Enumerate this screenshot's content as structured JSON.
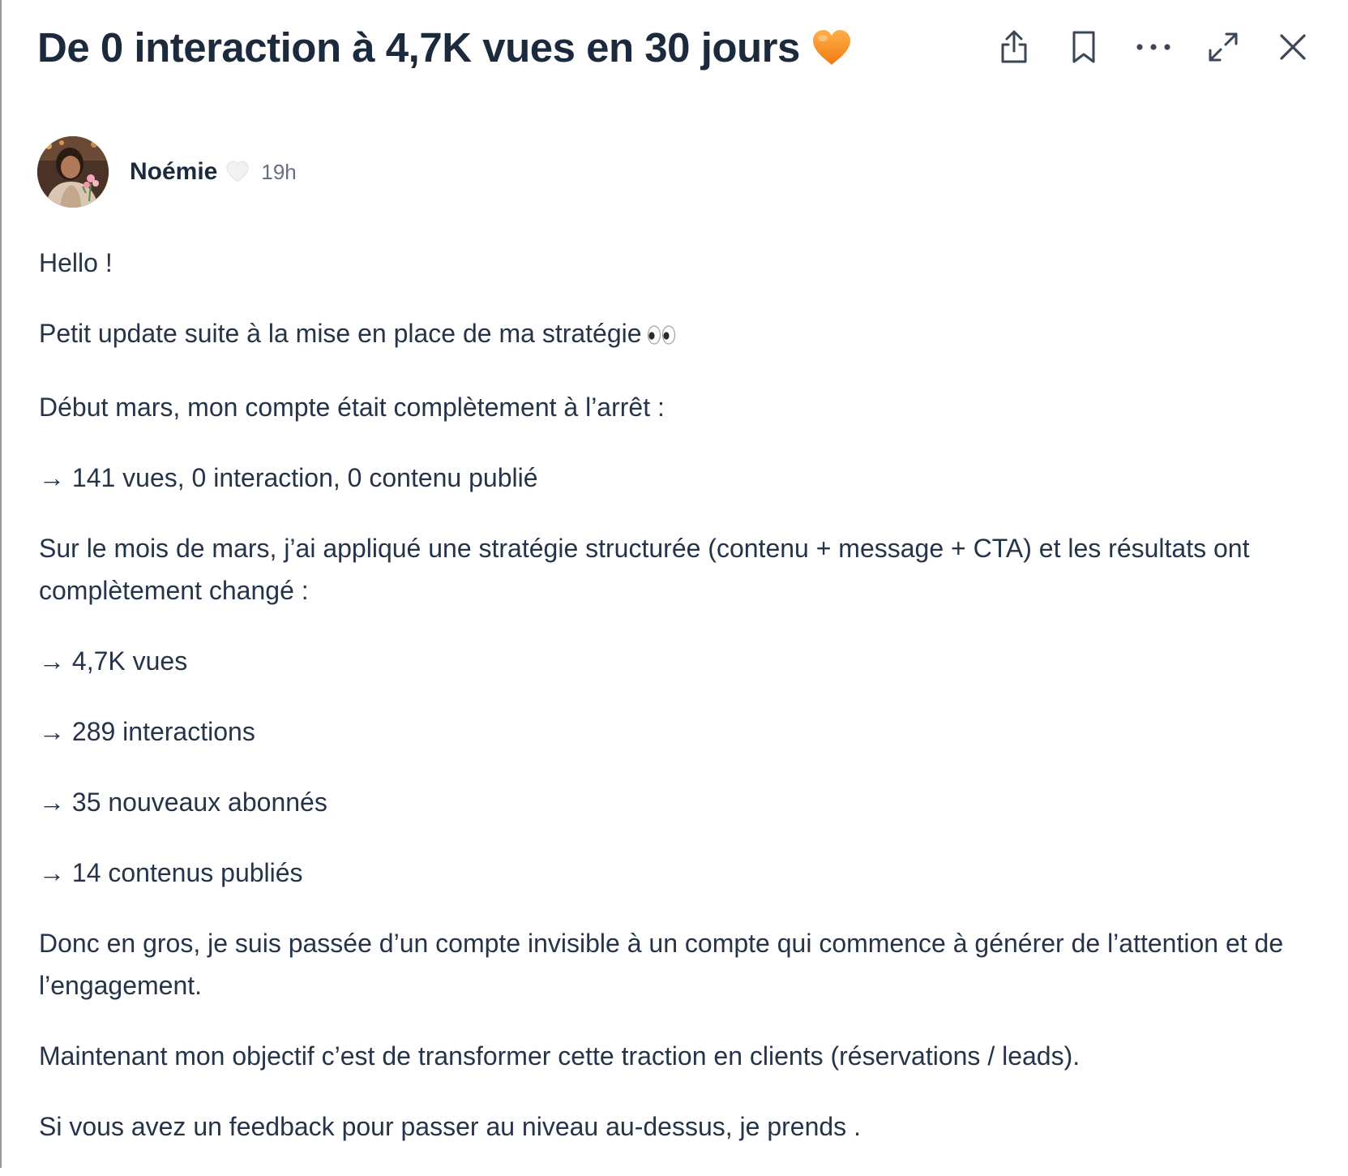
{
  "post": {
    "title": "De 0 interaction à 4,7K vues en 30 jours",
    "title_emoji": "orange-heart-icon",
    "author": {
      "name": "Noémie",
      "badge": "white-heart-icon",
      "time": "19h"
    },
    "paragraphs": [
      "Hello !",
      "Petit update suite à la mise en place de ma stratégie",
      "Début mars, mon compte était complètement à l’arrêt :",
      "→ 141 vues, 0 interaction, 0 contenu publié",
      "Sur le mois de mars, j’ai appliqué une stratégie structurée (contenu + message + CTA) et les résultats ont complètement changé :",
      "→ 4,7K vues",
      "→ 289 interactions",
      "→ 35 nouveaux abonnés",
      "→ 14 contenus publiés",
      "Donc en gros, je suis passée d’un compte invisible à un compte qui commence à générer de l’attention et de l’engagement.",
      "Maintenant mon objectif c’est de transformer cette traction en clients (réservations / leads).",
      "Si vous avez un feedback pour passer au niveau au-dessus, je prends ."
    ],
    "paragraph_2_emoji": "eyes-icon"
  },
  "toolbar": {
    "icons": [
      "share-icon",
      "bookmark-icon",
      "more-icon",
      "expand-icon",
      "close-icon"
    ]
  },
  "colors": {
    "title": "#1c2a3e",
    "body_text": "#26344a",
    "muted": "#667085",
    "icon": "#3b4656",
    "heart": "#f7941d"
  }
}
